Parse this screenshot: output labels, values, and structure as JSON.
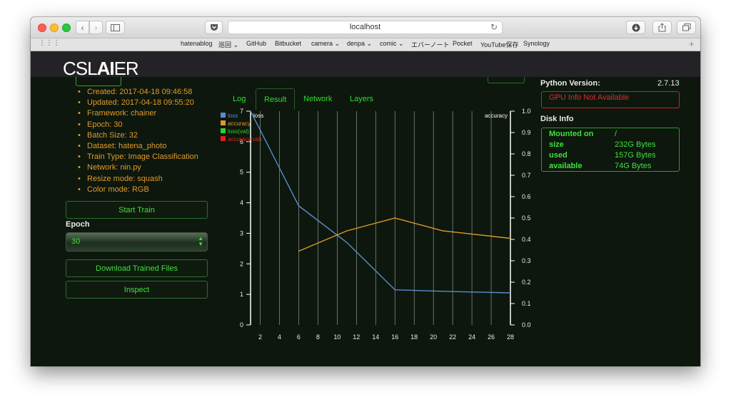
{
  "browser": {
    "url": "localhost",
    "bookmarks": [
      "hatenablog",
      "巡回 ⌄",
      "GitHub",
      "Bitbucket",
      "camera ⌄",
      "denpa ⌄",
      "comic ⌄",
      "エバーノート",
      "Pocket",
      "YouTube保存",
      "Synology"
    ]
  },
  "app": {
    "logo_prefix": "CSL",
    "logo_bold": "AI",
    "logo_suffix": "ER"
  },
  "model": {
    "created": "Created: 2017-04-18 09:46:58",
    "updated": "Updated: 2017-04-18 09:55:20",
    "framework": "Framework: chainer",
    "epoch": "Epoch: 30",
    "batch_size": "Batch Size: 32",
    "dataset": "Dataset: hatena_photo",
    "train_type": "Train Type: Image Classification",
    "network": "Network: nin.py",
    "resize_mode": "Resize mode: squash",
    "color_mode": "Color mode: RGB"
  },
  "actions": {
    "start_train": "Start Train",
    "epoch_label": "Epoch",
    "epoch_selected": "30",
    "download": "Download Trained Files",
    "inspect": "Inspect"
  },
  "tabs": [
    "Log",
    "Result",
    "Network",
    "Layers"
  ],
  "system": {
    "python_label": "Python Version:",
    "python_value": "2.7.13",
    "gpu_info": "GPU Info Not Available",
    "disk_title": "Disk Info",
    "disk": [
      {
        "key": "Mounted on",
        "value": "/"
      },
      {
        "key": "size",
        "value": "232G Bytes"
      },
      {
        "key": "used",
        "value": "157G Bytes"
      },
      {
        "key": "available",
        "value": "74G Bytes"
      }
    ]
  },
  "chart_data": {
    "type": "line",
    "left_axis_label": "loss",
    "right_axis_label": "accuracy",
    "x_ticks": [
      2,
      4,
      6,
      8,
      10,
      12,
      14,
      16,
      18,
      20,
      22,
      24,
      26,
      28
    ],
    "y_left_ticks": [
      0,
      1,
      2,
      3,
      4,
      5,
      6,
      7
    ],
    "y_left_lim": [
      0,
      7
    ],
    "y_right_ticks": [
      "0.0",
      "0.1",
      "0.2",
      "0.3",
      "0.4",
      "0.5",
      "0.6",
      "0.7",
      "0.8",
      "0.9",
      "1.0"
    ],
    "y_right_lim": [
      0,
      1
    ],
    "xlim": [
      1,
      28
    ],
    "legend": [
      "loss",
      "accuracy",
      "loss(val)",
      "accuracy(val)"
    ],
    "legend_position": "top-left",
    "grid": "vertical",
    "series": [
      {
        "name": "loss",
        "axis": "left",
        "color": "#5b8cc8",
        "x": [
          1,
          6,
          11,
          16,
          21,
          28
        ],
        "values": [
          7.0,
          3.9,
          2.7,
          1.15,
          1.1,
          1.05
        ]
      },
      {
        "name": "accuracy",
        "axis": "right",
        "color": "#e0982a",
        "x": [
          6,
          11,
          16,
          21,
          28
        ],
        "values": [
          0.345,
          0.44,
          0.5,
          0.44,
          0.405
        ]
      },
      {
        "name": "loss(val)",
        "axis": "left",
        "color": "#2fcf2f",
        "x": [],
        "values": []
      },
      {
        "name": "accuracy(val)",
        "axis": "right",
        "color": "#e02020",
        "x": [],
        "values": []
      }
    ]
  }
}
